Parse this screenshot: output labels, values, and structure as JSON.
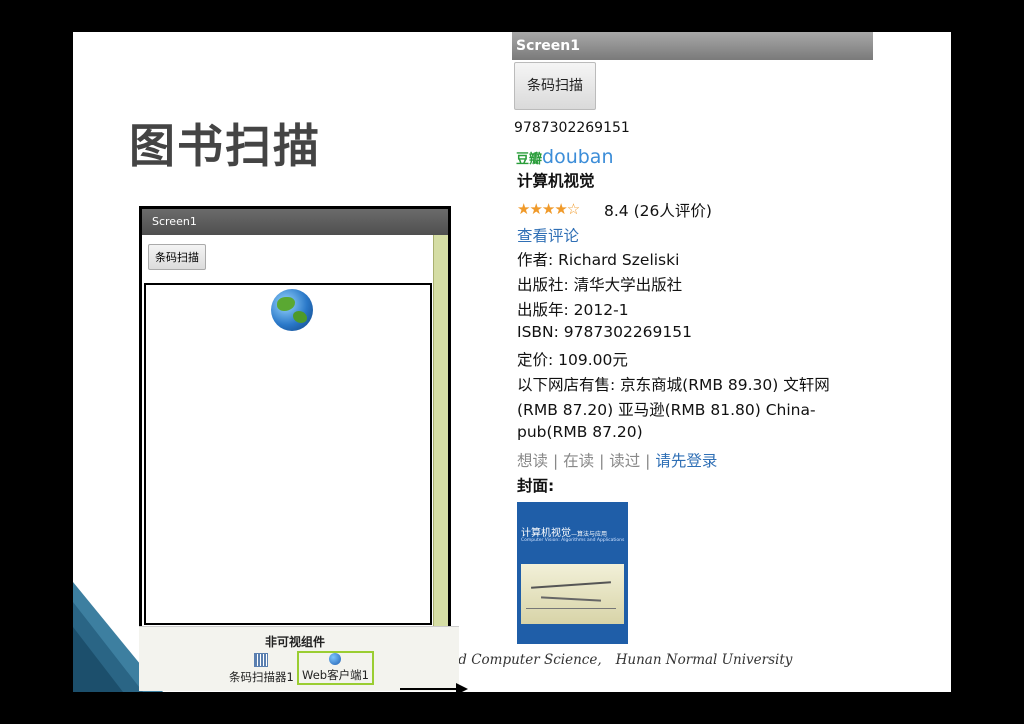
{
  "slide": {
    "title": "图书扫描",
    "footer_left": "tics and Computer Science,",
    "footer_right": "Hunan Normal University"
  },
  "left_phone": {
    "screen_title": "Screen1",
    "scan_button": "条码扫描",
    "webview_icon": "globe-icon"
  },
  "nonvisible_panel": {
    "title": "非可视组件",
    "items": [
      "条码扫描器1",
      "Web客户端1"
    ]
  },
  "right_phone": {
    "screen_title": "Screen1",
    "scan_button": "条码扫描",
    "barcode": "9787302269151",
    "douban_cn": "豆瓣",
    "douban_en": "douban",
    "book_title": "计算机视觉",
    "stars": "★★★★☆",
    "rating": "8.4 (26人评价)",
    "review_link": "查看评论",
    "author": "作者: Richard Szeliski",
    "publisher": "出版社: 清华大学出版社",
    "pub_year": "出版年: 2012-1",
    "isbn": "ISBN: 9787302269151",
    "price": "定价: 109.00元",
    "stores_line1": "以下网店有售: 京东商城(RMB 89.30) 文轩网",
    "stores_line2": "(RMB 87.20) 亚马逊(RMB 81.80) China-",
    "stores_line3": "pub(RMB 87.20)",
    "want_read": "想读",
    "reading": "在读",
    "read": "读过",
    "login": "请先登录",
    "cover_label": "封面:",
    "cover_title": "计算机视觉",
    "cover_subtitle": "—算法与应用",
    "cover_en": "Computer Vision: Algorithms and Applications"
  },
  "colors": {
    "link": "#2f6fb5",
    "stars": "#f09a2a",
    "cover_blue": "#1f5ea8",
    "selected_border": "#9acd32"
  }
}
